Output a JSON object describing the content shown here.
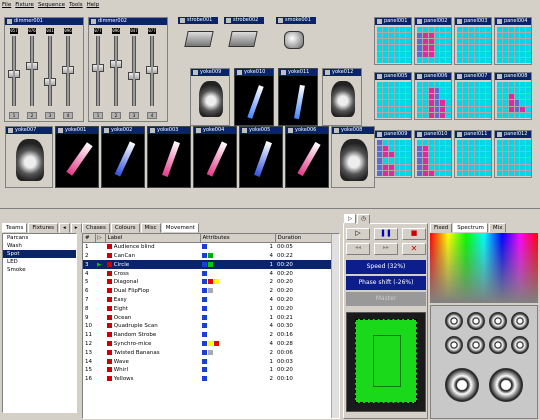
{
  "menu": [
    "File",
    "Fixture",
    "Sequence",
    "Tools",
    "Help"
  ],
  "dimmers": [
    {
      "title": "dimmer001",
      "values": [
        "057",
        "076",
        "041",
        "096"
      ],
      "channels": [
        "1",
        "2",
        "3",
        "4"
      ]
    },
    {
      "title": "dimmer002",
      "values": [
        "077",
        "096",
        "047",
        "077"
      ],
      "channels": [
        "1",
        "2",
        "3",
        "4"
      ]
    }
  ],
  "strobes": [
    "strobe001",
    "strobe002",
    "smoke001"
  ],
  "yokes_mid": [
    "yoke009",
    "yoke010",
    "yoke011",
    "yoke012"
  ],
  "yokes_bottom": [
    "yoke007",
    "yoke001",
    "yoke002",
    "yoke003",
    "yoke004",
    "yoke005",
    "yoke006",
    "yoke008"
  ],
  "panels": [
    "panel001",
    "panel002",
    "panel003",
    "panel004",
    "panel005",
    "panel006",
    "panel007",
    "panel008",
    "panel009",
    "panel010",
    "panel011",
    "panel012"
  ],
  "tree": {
    "tabs": [
      "Teams",
      "Fixtures"
    ],
    "items": [
      "Parcans",
      "Wash",
      "Spot",
      "LED",
      "Smoke"
    ],
    "selected": 2
  },
  "seq": {
    "tabs": [
      "Chases",
      "Colours",
      "Misc",
      "Movement"
    ],
    "headers": [
      "#",
      "Label",
      "Attributes",
      "Duration"
    ],
    "rows": [
      [
        "1",
        "Audience blind",
        "1",
        "00:05"
      ],
      [
        "2",
        "CanCan",
        "4",
        "00:22"
      ],
      [
        "3",
        "Circle",
        "1",
        "00:20"
      ],
      [
        "4",
        "Cross",
        "4",
        "00:20"
      ],
      [
        "5",
        "Diagonal",
        "2",
        "00:20"
      ],
      [
        "6",
        "Dual FlipFlop",
        "2",
        "00:20"
      ],
      [
        "7",
        "Easy",
        "4",
        "00:20"
      ],
      [
        "8",
        "Eight",
        "1",
        "00:20"
      ],
      [
        "9",
        "Ocean",
        "1",
        "00:21"
      ],
      [
        "10",
        "Quadruple Scan",
        "4",
        "00:30"
      ],
      [
        "11",
        "Random Strobe",
        "2",
        "00:16"
      ],
      [
        "12",
        "Synchro-mice",
        "4",
        "00:28"
      ],
      [
        "13",
        "Twisted Bananas",
        "2",
        "00:06"
      ],
      [
        "14",
        "Wave",
        "1",
        "00:03"
      ],
      [
        "15",
        "Whirl",
        "1",
        "00:20"
      ],
      [
        "16",
        "Yellows",
        "2",
        "00:10"
      ]
    ],
    "selected": 2
  },
  "player": {
    "speed": "Speed (32%)",
    "phase": "Phase shift (-26%)",
    "master": "Master"
  },
  "colour": {
    "tabs": [
      "Fixed",
      "Spectrum",
      "Mix"
    ]
  }
}
